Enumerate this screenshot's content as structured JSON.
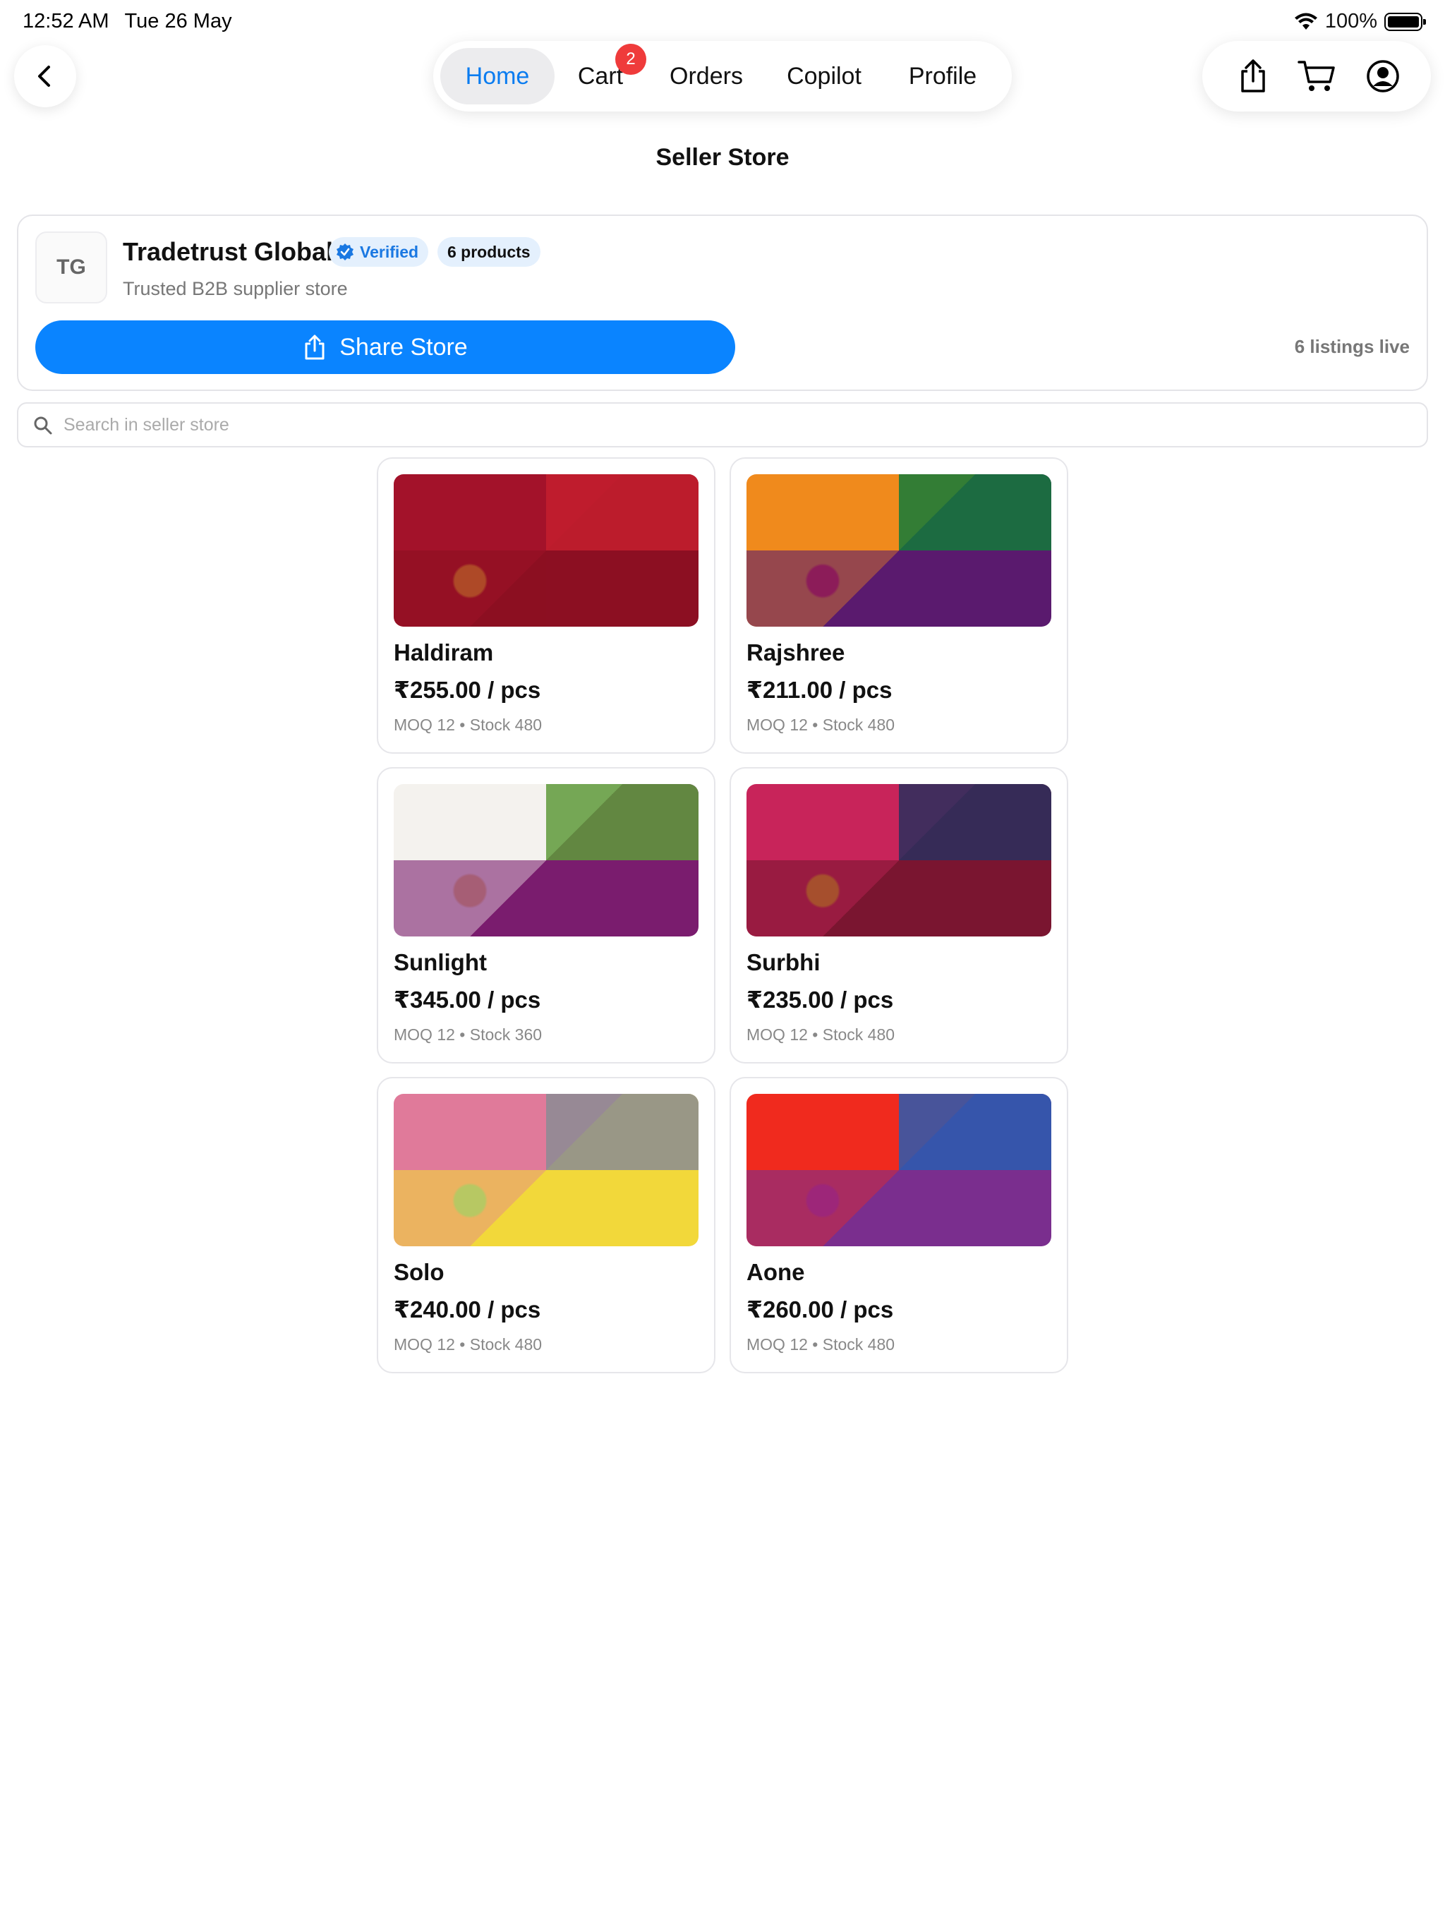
{
  "status_bar": {
    "time": "12:52 AM",
    "date": "Tue 26 May",
    "battery": "100%"
  },
  "nav": {
    "tabs": [
      {
        "label": "Home",
        "active": true
      },
      {
        "label": "Cart",
        "active": false
      },
      {
        "label": "Orders",
        "active": false
      },
      {
        "label": "Copilot",
        "active": false
      },
      {
        "label": "Profile",
        "active": false
      }
    ],
    "cart_badge": "2",
    "icons": [
      "back-icon",
      "share-icon",
      "cart-icon",
      "account-icon"
    ]
  },
  "page": {
    "title": "Seller Store"
  },
  "store": {
    "initials": "TG",
    "name": "Tradetrust Global",
    "verified_label": "Verified",
    "products_label": "6 products",
    "subtitle": "Trusted B2B supplier store",
    "share_label": "Share Store",
    "listings_label": "6 listings live"
  },
  "search": {
    "placeholder": "Search in seller store",
    "value": ""
  },
  "products": [
    {
      "name": "Haldiram",
      "price": "₹255.00 / pcs",
      "meta": "MOQ 12 • Stock 480",
      "image_colors": [
        "#a3122a",
        "#8c0f22",
        "#c41e2e",
        "#e0a030"
      ]
    },
    {
      "name": "Rajshree",
      "price": "₹211.00 / pcs",
      "meta": "MOQ 12 • Stock 480",
      "image_colors": [
        "#f08a1c",
        "#5a1a6e",
        "#127a3a",
        "#d8203a"
      ]
    },
    {
      "name": "Sunlight",
      "price": "₹345.00 / pcs",
      "meta": "MOQ 12 • Stock 360",
      "image_colors": [
        "#f4f2ee",
        "#7a1c6e",
        "#5e9a3a",
        "#e8c080"
      ]
    },
    {
      "name": "Surbhi",
      "price": "₹235.00 / pcs",
      "meta": "MOQ 12 • Stock 480",
      "image_colors": [
        "#c8245a",
        "#7a1530",
        "#2a2f5e",
        "#e9a52a"
      ]
    },
    {
      "name": "Solo",
      "price": "₹240.00 / pcs",
      "meta": "MOQ 12 • Stock 480",
      "image_colors": [
        "#e07a9a",
        "#f2d83a",
        "#8a8c94",
        "#5fb0a0"
      ]
    },
    {
      "name": "Aone",
      "price": "₹260.00 / pcs",
      "meta": "MOQ 12 • Stock 480",
      "image_colors": [
        "#f02a1e",
        "#7a2e8e",
        "#2a5cb0",
        "#d21a5a"
      ]
    }
  ]
}
